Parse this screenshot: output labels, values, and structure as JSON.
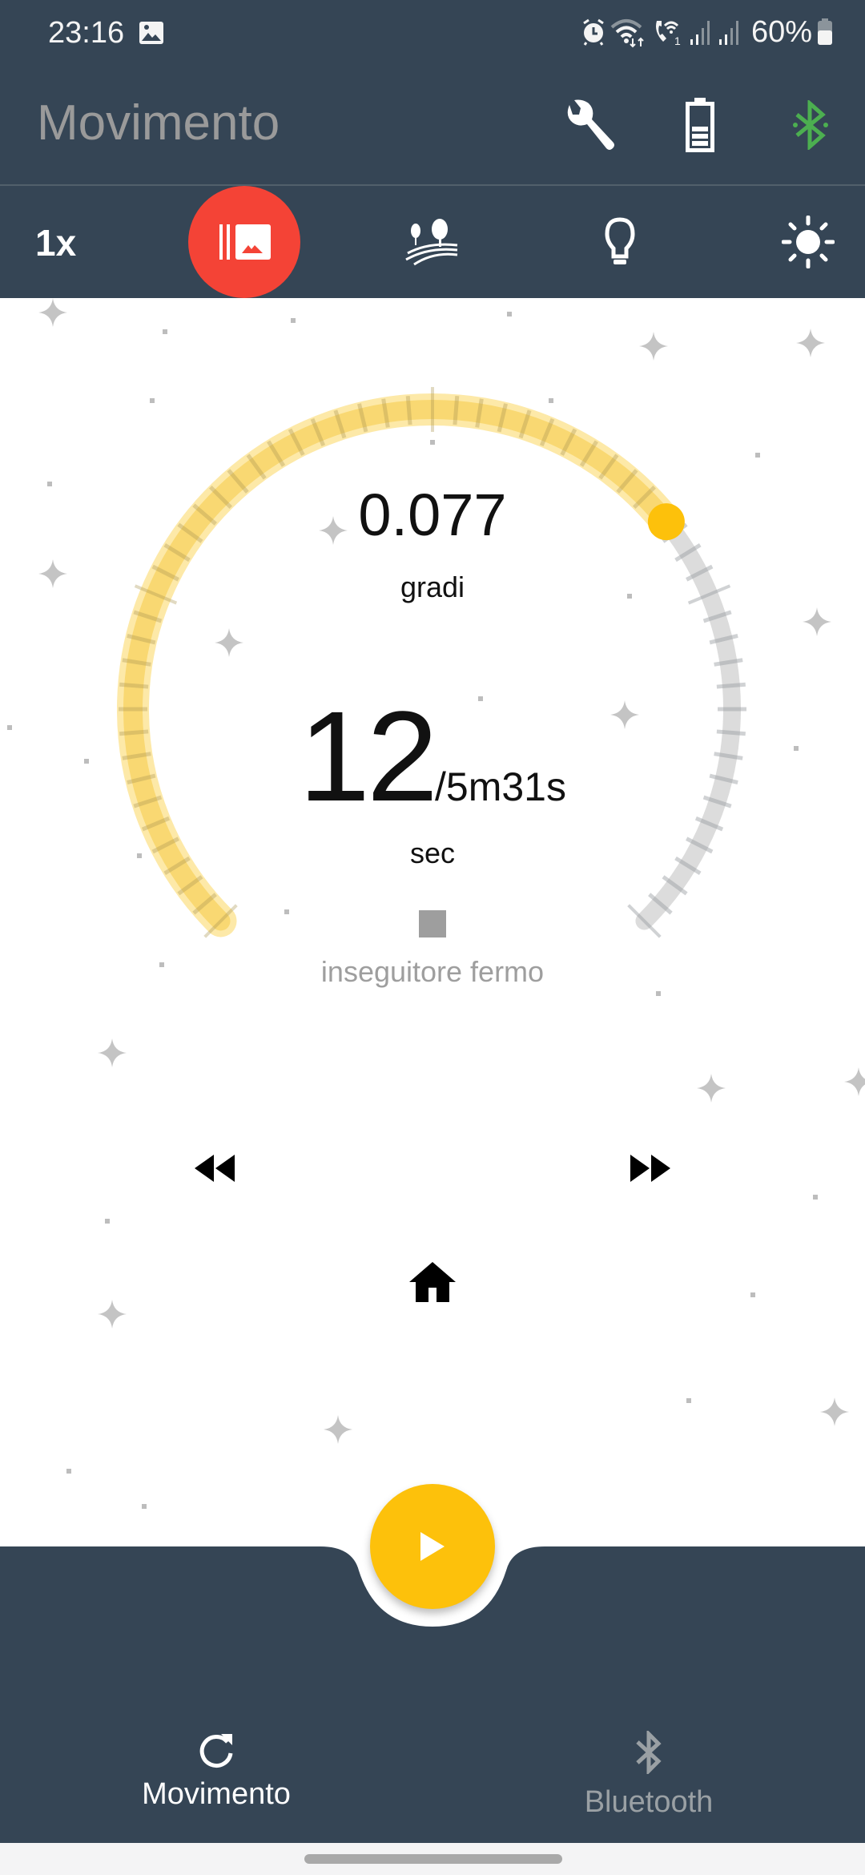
{
  "status_bar": {
    "time": "23:16",
    "battery_percent": "60%",
    "icons": [
      "gallery-icon",
      "alarm-icon",
      "wifi-icon",
      "wifi-calling-icon",
      "signal-icon",
      "signal-icon",
      "battery-icon"
    ]
  },
  "app_bar": {
    "title": "Movimento",
    "actions": [
      {
        "name": "settings",
        "icon": "wrench-icon"
      },
      {
        "name": "battery",
        "icon": "battery-icon"
      },
      {
        "name": "bluetooth",
        "icon": "bluetooth-icon",
        "color": "#4caf50"
      }
    ]
  },
  "toolbar": {
    "speed": "1x",
    "modes": [
      {
        "name": "gallery-mode",
        "icon": "photo-library-icon",
        "active": true
      },
      {
        "name": "landscape-mode",
        "icon": "landscape-icon",
        "active": false
      },
      {
        "name": "light-mode",
        "icon": "lightbulb-icon",
        "active": false
      },
      {
        "name": "brightness-mode",
        "icon": "sun-icon",
        "active": false
      }
    ],
    "active_color": "#f44336"
  },
  "gauge": {
    "progress_fraction": 0.69,
    "degrees_value": "0.077",
    "degrees_unit": "gradi",
    "elapsed_value": "12",
    "total_duration": "/5m31s",
    "elapsed_unit": "sec",
    "tracker_status": "inseguitore fermo",
    "fill_color": "#f9d872",
    "track_color": "#dcdcdc",
    "knob_color": "#fdc10b"
  },
  "controls": {
    "rewind_icon": "fast-rewind-icon",
    "forward_icon": "fast-forward-icon",
    "home_icon": "home-icon"
  },
  "fab": {
    "icon": "play-icon",
    "color": "#fdc10b"
  },
  "bottom_nav": {
    "items": [
      {
        "label": "Movimento",
        "icon": "refresh-icon",
        "active": true
      },
      {
        "label": "Bluetooth",
        "icon": "bluetooth-icon",
        "active": false
      }
    ]
  },
  "colors": {
    "primary_dark": "#354555",
    "accent": "#fdc10b"
  }
}
